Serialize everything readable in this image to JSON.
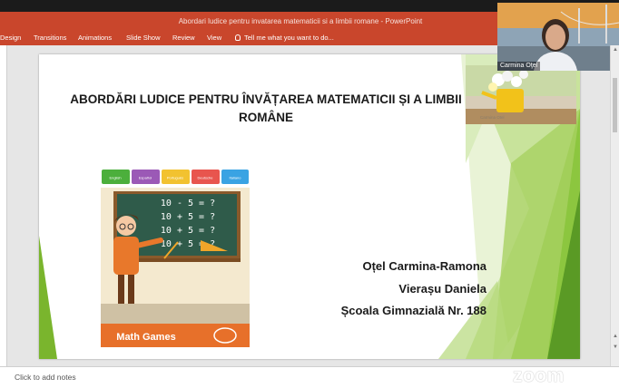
{
  "window": {
    "title": "Abordari ludice pentru invatarea matematicii si a limbii romane - PowerPoint"
  },
  "ribbon": {
    "tabs": [
      "Design",
      "Transitions",
      "Animations",
      "Slide Show",
      "Review",
      "View"
    ],
    "tell_me": "Tell me what you want to do..."
  },
  "slide": {
    "title": "ABORDĂRI LUDICE PENTRU ÎNVĂȚAREA MATEMATICII ȘI A LIMBII ROMÂNE",
    "authors": [
      "Oțel Carmina-Ramona",
      "Vierașu Daniela",
      "Școala Gimnazială Nr. 188"
    ],
    "image": {
      "language_tabs": [
        {
          "label": "English",
          "color": "#4caf3c"
        },
        {
          "label": "Español",
          "color": "#9b59b6"
        },
        {
          "label": "Português",
          "color": "#f2c230"
        },
        {
          "label": "Deutsche",
          "color": "#e8554e"
        },
        {
          "label": "Italiano",
          "color": "#3aa3e3"
        }
      ],
      "equations": [
        "10 - 5 = ?",
        "10 + 5 = ?",
        "10 + 5 = ?",
        "10 + 5 = ?"
      ],
      "banner": "Math Games"
    },
    "flowers_caption": "Carmina Otel"
  },
  "video": {
    "participant_name": "Carmina Oţel"
  },
  "notes": {
    "placeholder": "Click to add notes"
  },
  "watermark": "zoom"
}
